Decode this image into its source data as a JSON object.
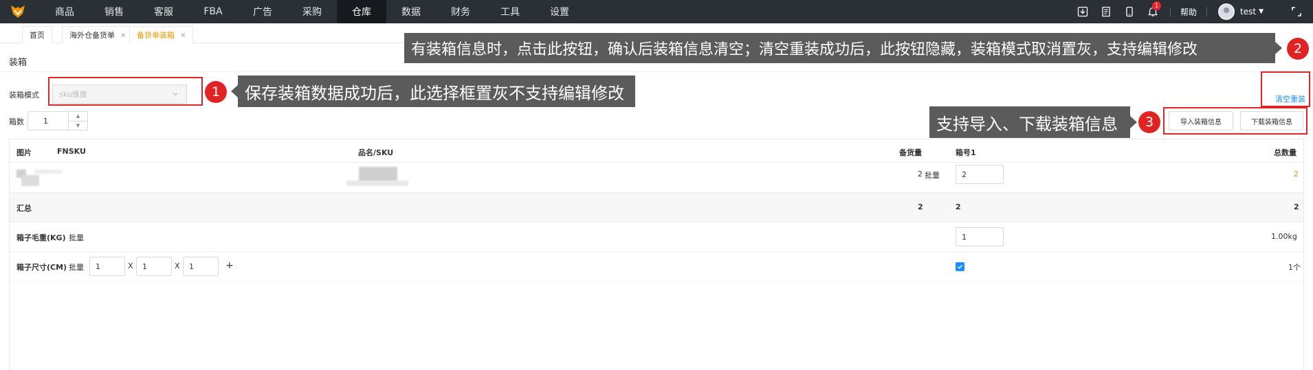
{
  "nav": {
    "items": [
      "商品",
      "销售",
      "客服",
      "FBA",
      "广告",
      "采购",
      "仓库",
      "数据",
      "财务",
      "工具",
      "设置"
    ],
    "active": "仓库",
    "notification_count": "1",
    "help": "帮助",
    "username": "test",
    "icons": [
      "download-icon",
      "task-list-icon",
      "mobile-icon",
      "bell-icon",
      "expand-icon"
    ]
  },
  "tabs": [
    {
      "label": "首页",
      "closable": false,
      "active": false
    },
    {
      "label": "海外仓备货单",
      "closable": true,
      "active": false
    },
    {
      "label": "备货单装箱",
      "closable": true,
      "active": true
    }
  ],
  "tab_close": "×",
  "page": {
    "title": "装箱",
    "mode_label": "装箱模式",
    "mode_value": "sku维度",
    "box_count_label": "箱数",
    "box_count": "1",
    "clear_repack": "清空重装",
    "import_btn": "导入装箱信息",
    "download_btn": "下载装箱信息"
  },
  "table": {
    "headers": {
      "image": "图片",
      "fnsku": "FNSKU",
      "name_sku": "品名/SKU",
      "stock_qty": "备货量",
      "box1": "箱号1",
      "total": "总数量"
    },
    "item_row": {
      "stock_qty": "2",
      "batch": "批量",
      "box1_value": "2",
      "total": "2"
    },
    "summary_row": {
      "label": "汇总",
      "stock_qty": "2",
      "box1": "2",
      "total": "2"
    },
    "weight_row": {
      "label": "箱子毛重(KG)",
      "batch": "批量",
      "value": "1",
      "total": "1.00kg"
    },
    "size_row": {
      "label": "箱子尺寸(CM)",
      "batch": "批量",
      "l": "1",
      "w": "1",
      "h": "1",
      "sep": "X",
      "add": "+",
      "total": "1个"
    }
  },
  "annotations": {
    "a1": {
      "num": "1",
      "text": "保存装箱数据成功后，此选择框置灰不支持编辑修改"
    },
    "a2": {
      "num": "2",
      "text": "有装箱信息时，点击此按钮，确认后装箱信息清空；清空重装成功后，此按钮隐藏，装箱模式取消置灰，支持编辑修改"
    },
    "a3": {
      "num": "3",
      "text": "支持导入、下载装箱信息"
    }
  },
  "colors": {
    "nav_bg": "#2b3037",
    "accent_link": "#1890ff",
    "active_tab": "#f29400",
    "annotation_red": "#e02424",
    "total_orange": "#f29400"
  }
}
